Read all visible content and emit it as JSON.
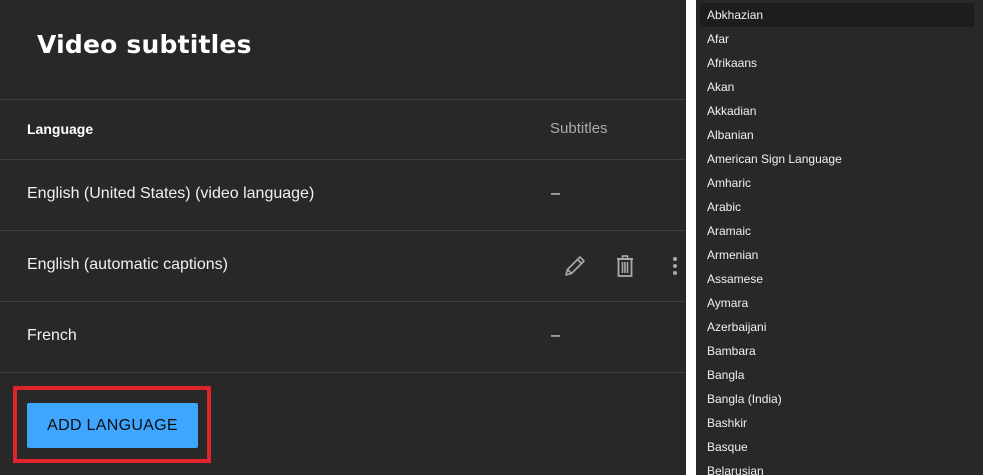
{
  "page": {
    "title": "Video subtitles"
  },
  "table": {
    "headers": {
      "language": "Language",
      "subtitles": "Subtitles"
    },
    "rows": [
      {
        "language": "English (United States) (video language)",
        "subtitles": "–"
      },
      {
        "language": "English (automatic captions)",
        "subtitles": "",
        "actions": [
          "pencil-icon",
          "trash-icon",
          "more-vert-icon"
        ]
      },
      {
        "language": "French",
        "subtitles": "–"
      }
    ]
  },
  "add_language_button": {
    "label": "ADD LANGUAGE"
  },
  "highlight_color": "#e1242c",
  "accent_color": "#3ea6ff",
  "language_dropdown": {
    "selected": "Abkhazian",
    "options": [
      "Abkhazian",
      "Afar",
      "Afrikaans",
      "Akan",
      "Akkadian",
      "Albanian",
      "American Sign Language",
      "Amharic",
      "Arabic",
      "Aramaic",
      "Armenian",
      "Assamese",
      "Aymara",
      "Azerbaijani",
      "Bambara",
      "Bangla",
      "Bangla (India)",
      "Bashkir",
      "Basque",
      "Belarusian"
    ]
  }
}
